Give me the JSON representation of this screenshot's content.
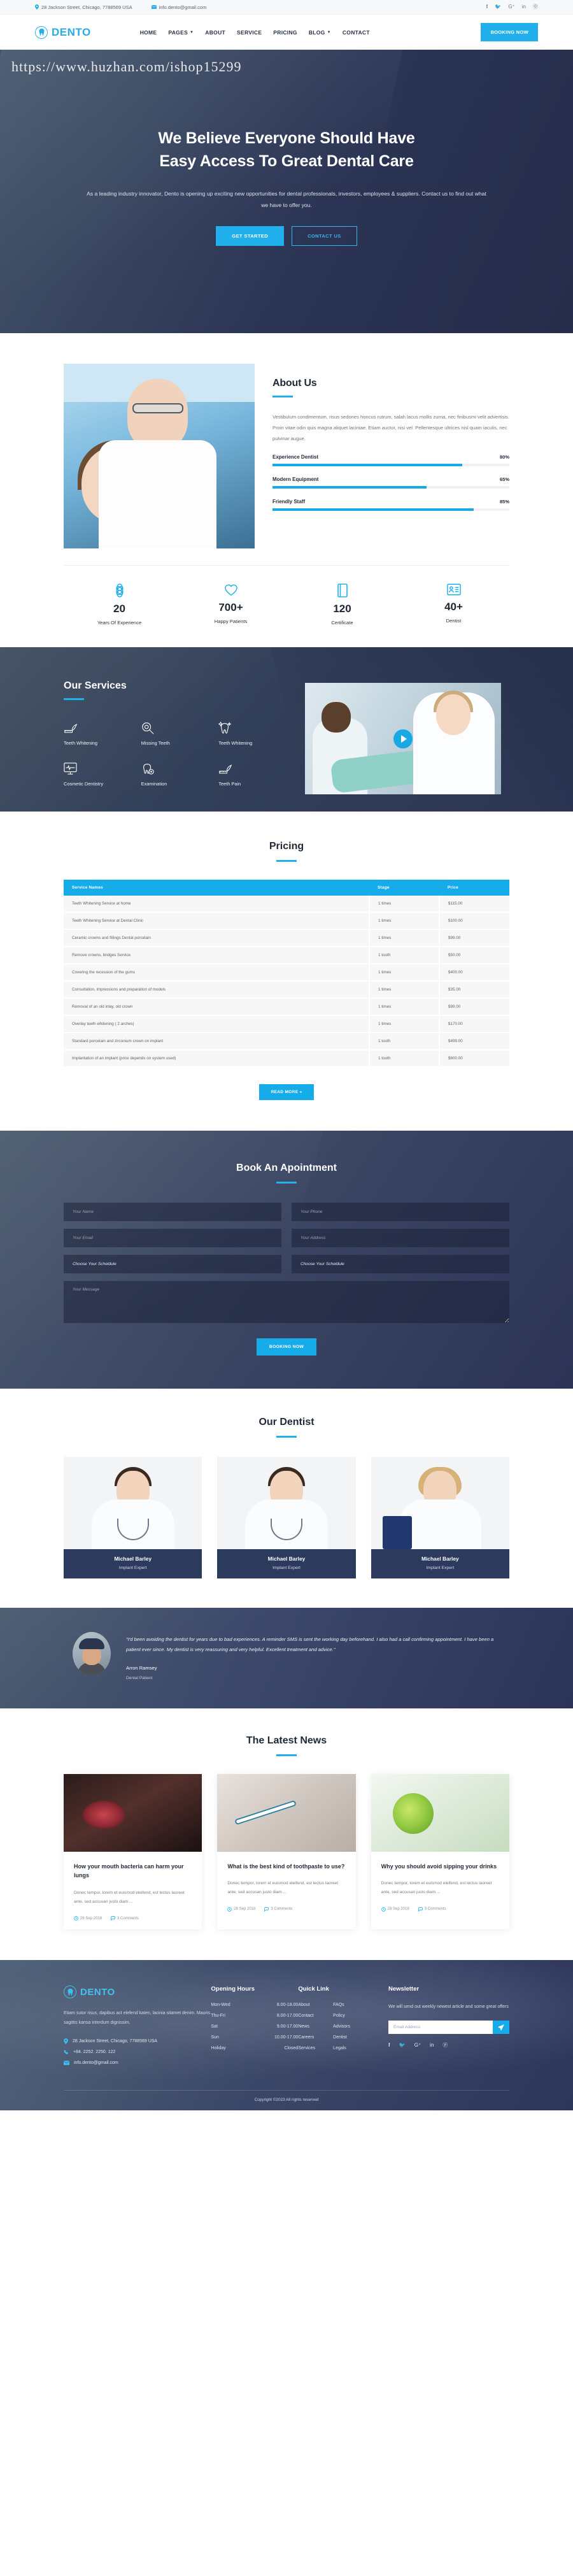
{
  "topbar": {
    "address": "28 Jackson Street, Chicago, 7788569 USA",
    "email": "info.dento@gmail.com",
    "socials": [
      "facebook-icon",
      "twitter-icon",
      "google-plus-icon",
      "linkedin-icon",
      "pinterest-icon"
    ]
  },
  "header": {
    "brand": "DENTO",
    "nav": [
      {
        "label": "HOME",
        "caret": false
      },
      {
        "label": "PAGES",
        "caret": true
      },
      {
        "label": "ABOUT",
        "caret": false
      },
      {
        "label": "SERVICE",
        "caret": false
      },
      {
        "label": "PRICING",
        "caret": false
      },
      {
        "label": "BLOG",
        "caret": true
      },
      {
        "label": "CONTACT",
        "caret": false
      }
    ],
    "booking_label": "BOOKING NOW"
  },
  "hero": {
    "watermark": "https://www.huzhan.com/ishop15299",
    "title_line1": "We Believe Everyone Should Have",
    "title_line2": "Easy Access To Great Dental Care",
    "subtitle": "As a leading industry innovator, Dento is opening up exciting new opportunities for dental professionals, investors, employees & suppliers. Contact us to find out what we have to offer you.",
    "btn_primary": "GET STARTED",
    "btn_outline": "CONTACT US"
  },
  "about": {
    "title": "About Us",
    "paragraph": "Vestibulum condimentum, risus sedones honcus rutrum, salah lacus mollis zurna, nec finibusmi velit advertisis. Proin vitae odin quis magna aliquet laciniae. Etiam auctor, nisi vel. Pellentesque ultrices nisl quam iaculis, nec pulvinar augue.",
    "skills": [
      {
        "name": "Experience Dentist",
        "percent": "80%",
        "value": 80
      },
      {
        "name": "Modern Equipment",
        "percent": "65%",
        "value": 65
      },
      {
        "name": "Friendly Staff",
        "percent": "85%",
        "value": 85
      }
    ]
  },
  "counters": [
    {
      "icon": "atom-icon",
      "number": "20",
      "label": "Years Of Experience"
    },
    {
      "icon": "heart-icon",
      "number": "700+",
      "label": "Happy Patients"
    },
    {
      "icon": "certificate-icon",
      "number": "120",
      "label": "Certificate"
    },
    {
      "icon": "id-card-icon",
      "number": "40+",
      "label": "Dentist"
    }
  ],
  "services": {
    "title": "Our Services",
    "items": [
      {
        "icon": "toothbrush-icon",
        "name": "Teeth Whitening"
      },
      {
        "icon": "magnifier-tooth-icon",
        "name": "Missing Teeth"
      },
      {
        "icon": "sparkle-tooth-icon",
        "name": "Teeth Whitening"
      },
      {
        "icon": "monitor-icon",
        "name": "Cosmetic Dentistry"
      },
      {
        "icon": "tooth-check-icon",
        "name": "Examination"
      },
      {
        "icon": "toothbrush-icon",
        "name": "Teeth Pain"
      }
    ],
    "video_play": "play-button"
  },
  "pricing": {
    "title": "Pricing",
    "columns": [
      "Service Names",
      "Stage",
      "Price"
    ],
    "rows": [
      [
        "Teeth Whitening Service at home",
        "1 times",
        "$115.00"
      ],
      [
        "Teeth Whitening Service at Dental Clinic",
        "1 times",
        "$100.00"
      ],
      [
        "Ceramic crowns and fillings Dental porcelain",
        "1 times",
        "$99.00"
      ],
      [
        "Remove crowns, bridges Service",
        "1 tooth",
        "$50.00"
      ],
      [
        "Covering the recession of the gums",
        "1 times",
        "$400.00"
      ],
      [
        "Consultation, impressions and preparation of models",
        "1 times",
        "$35.00"
      ],
      [
        "Removal of an old inlay, old crown",
        "1 times",
        "$99.00"
      ],
      [
        "Overlay teeth whitening ( 2 arches)",
        "1 times",
        "$170.00"
      ],
      [
        "Standard porcelain and zirconium crown on implant",
        "1 tooth",
        "$499.00"
      ],
      [
        "Implantation of an implant (price depends on system used)",
        "1 tooth",
        "$600.00"
      ]
    ],
    "read_more": "READ MORE »"
  },
  "appointment": {
    "title": "Book An Apointment",
    "fields": [
      {
        "name": "name",
        "placeholder": "Your Name",
        "type": "input"
      },
      {
        "name": "phone",
        "placeholder": "Your Phone",
        "type": "input"
      },
      {
        "name": "email",
        "placeholder": "Your Email",
        "type": "input"
      },
      {
        "name": "address",
        "placeholder": "Your Address",
        "type": "input"
      },
      {
        "name": "schedule-date",
        "placeholder": "Choose Your Scheldule",
        "type": "select"
      },
      {
        "name": "schedule-time",
        "placeholder": "Choose Your Scheldule",
        "type": "select"
      }
    ],
    "message_placeholder": "Your Message",
    "submit_label": "BOOKING NOW"
  },
  "dentists": {
    "title": "Our Dentist",
    "cards": [
      {
        "name": "Michael Barley",
        "role": "Implant Expert"
      },
      {
        "name": "Michael Barley",
        "role": "Implant Expert"
      },
      {
        "name": "Michael Barley",
        "role": "Implant Expert"
      }
    ]
  },
  "testimonial": {
    "quote": "\"I'd been avoiding the dentist for years due to bad experiences. A reminder SMS is sent the working day beforehand. I also had a call confirming appointment. I have been a patient ever since. My dentist is very reassuring and very helpful. Excellent treatment and advice.\"",
    "name": "Arron Ramsey",
    "role": "Dental Patient"
  },
  "news": {
    "title": "The Latest News",
    "posts": [
      {
        "title": "How your mouth bacteria can harm your lungs",
        "excerpt": "Donec tempor, lorem et euismod eleifend, est lectus laoreet ante, sed accusan justo diam ...",
        "date": "28 Sep 2018",
        "comments": "3 Comments"
      },
      {
        "title": "What is the best kind of toothpaste to use?",
        "excerpt": "Donec tempor, lorem et euismod eleifend, est lectus laoreet ante, sed accusan justo diam ...",
        "date": "28 Sep 2018",
        "comments": "3 Comments"
      },
      {
        "title": "Why you should avoid sipping your drinks",
        "excerpt": "Donec tempor, lorem et euismod eleifend, est lectus laoreet ante, sed accusan justo diam ...",
        "date": "28 Sep 2018",
        "comments": "3 Comments"
      }
    ]
  },
  "footer": {
    "brand": "DENTO",
    "description": "Etiam sutor risus, dapibus act elefend katen, lacinia sitamet denim. Mauris sagittis kansa interdum dignissim.",
    "address": "28 Jackson Street, Chicago, 7788569 USA",
    "phone": "+84. 2252. 2250. 122",
    "email": "info.dento@gmail.com",
    "hours_title": "Opening Hours",
    "hours": [
      {
        "day": "Mon-Wed",
        "time": "8.00-18.00"
      },
      {
        "day": "Thu-Fri",
        "time": "8.00-17.00"
      },
      {
        "day": "Sat",
        "time": "9.00-17.00"
      },
      {
        "day": "Sun",
        "time": "10.00-17.00"
      },
      {
        "day": "Holiday",
        "time": "Closed"
      }
    ],
    "quicklink_title": "Quick Link",
    "quicklinks_col1": [
      "About",
      "Contact",
      "News",
      "Careers",
      "Services"
    ],
    "quicklinks_col2": [
      "FAQs",
      "Policy",
      "Advisors",
      "Dentist",
      "Legals"
    ],
    "newsletter_title": "Newsletter",
    "newsletter_desc": "We will send out weekly newest article and some great offers",
    "newsletter_placeholder": "Email Address",
    "socials": [
      "facebook-icon",
      "twitter-icon",
      "google-plus-icon",
      "linkedin-icon",
      "pinterest-icon"
    ],
    "copyright": "Copyright ©2023 All rights reserved"
  },
  "colors": {
    "accent": "#16ace9",
    "accent_light": "#22b0ec",
    "dark_navy": "#2c3356",
    "slate": "#3b4768",
    "text_dark": "#212a36",
    "text_muted": "#6e7680"
  }
}
